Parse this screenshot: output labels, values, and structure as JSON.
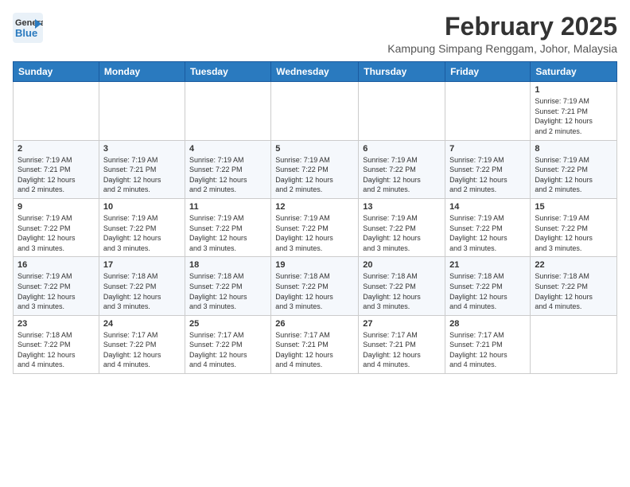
{
  "header": {
    "logo_general": "General",
    "logo_blue": "Blue",
    "month_year": "February 2025",
    "location": "Kampung Simpang Renggam, Johor, Malaysia"
  },
  "days_of_week": [
    "Sunday",
    "Monday",
    "Tuesday",
    "Wednesday",
    "Thursday",
    "Friday",
    "Saturday"
  ],
  "weeks": [
    [
      {
        "day": "",
        "info": ""
      },
      {
        "day": "",
        "info": ""
      },
      {
        "day": "",
        "info": ""
      },
      {
        "day": "",
        "info": ""
      },
      {
        "day": "",
        "info": ""
      },
      {
        "day": "",
        "info": ""
      },
      {
        "day": "1",
        "info": "Sunrise: 7:19 AM\nSunset: 7:21 PM\nDaylight: 12 hours\nand 2 minutes."
      }
    ],
    [
      {
        "day": "2",
        "info": "Sunrise: 7:19 AM\nSunset: 7:21 PM\nDaylight: 12 hours\nand 2 minutes."
      },
      {
        "day": "3",
        "info": "Sunrise: 7:19 AM\nSunset: 7:21 PM\nDaylight: 12 hours\nand 2 minutes."
      },
      {
        "day": "4",
        "info": "Sunrise: 7:19 AM\nSunset: 7:22 PM\nDaylight: 12 hours\nand 2 minutes."
      },
      {
        "day": "5",
        "info": "Sunrise: 7:19 AM\nSunset: 7:22 PM\nDaylight: 12 hours\nand 2 minutes."
      },
      {
        "day": "6",
        "info": "Sunrise: 7:19 AM\nSunset: 7:22 PM\nDaylight: 12 hours\nand 2 minutes."
      },
      {
        "day": "7",
        "info": "Sunrise: 7:19 AM\nSunset: 7:22 PM\nDaylight: 12 hours\nand 2 minutes."
      },
      {
        "day": "8",
        "info": "Sunrise: 7:19 AM\nSunset: 7:22 PM\nDaylight: 12 hours\nand 2 minutes."
      }
    ],
    [
      {
        "day": "9",
        "info": "Sunrise: 7:19 AM\nSunset: 7:22 PM\nDaylight: 12 hours\nand 3 minutes."
      },
      {
        "day": "10",
        "info": "Sunrise: 7:19 AM\nSunset: 7:22 PM\nDaylight: 12 hours\nand 3 minutes."
      },
      {
        "day": "11",
        "info": "Sunrise: 7:19 AM\nSunset: 7:22 PM\nDaylight: 12 hours\nand 3 minutes."
      },
      {
        "day": "12",
        "info": "Sunrise: 7:19 AM\nSunset: 7:22 PM\nDaylight: 12 hours\nand 3 minutes."
      },
      {
        "day": "13",
        "info": "Sunrise: 7:19 AM\nSunset: 7:22 PM\nDaylight: 12 hours\nand 3 minutes."
      },
      {
        "day": "14",
        "info": "Sunrise: 7:19 AM\nSunset: 7:22 PM\nDaylight: 12 hours\nand 3 minutes."
      },
      {
        "day": "15",
        "info": "Sunrise: 7:19 AM\nSunset: 7:22 PM\nDaylight: 12 hours\nand 3 minutes."
      }
    ],
    [
      {
        "day": "16",
        "info": "Sunrise: 7:19 AM\nSunset: 7:22 PM\nDaylight: 12 hours\nand 3 minutes."
      },
      {
        "day": "17",
        "info": "Sunrise: 7:18 AM\nSunset: 7:22 PM\nDaylight: 12 hours\nand 3 minutes."
      },
      {
        "day": "18",
        "info": "Sunrise: 7:18 AM\nSunset: 7:22 PM\nDaylight: 12 hours\nand 3 minutes."
      },
      {
        "day": "19",
        "info": "Sunrise: 7:18 AM\nSunset: 7:22 PM\nDaylight: 12 hours\nand 3 minutes."
      },
      {
        "day": "20",
        "info": "Sunrise: 7:18 AM\nSunset: 7:22 PM\nDaylight: 12 hours\nand 3 minutes."
      },
      {
        "day": "21",
        "info": "Sunrise: 7:18 AM\nSunset: 7:22 PM\nDaylight: 12 hours\nand 4 minutes."
      },
      {
        "day": "22",
        "info": "Sunrise: 7:18 AM\nSunset: 7:22 PM\nDaylight: 12 hours\nand 4 minutes."
      }
    ],
    [
      {
        "day": "23",
        "info": "Sunrise: 7:18 AM\nSunset: 7:22 PM\nDaylight: 12 hours\nand 4 minutes."
      },
      {
        "day": "24",
        "info": "Sunrise: 7:17 AM\nSunset: 7:22 PM\nDaylight: 12 hours\nand 4 minutes."
      },
      {
        "day": "25",
        "info": "Sunrise: 7:17 AM\nSunset: 7:22 PM\nDaylight: 12 hours\nand 4 minutes."
      },
      {
        "day": "26",
        "info": "Sunrise: 7:17 AM\nSunset: 7:21 PM\nDaylight: 12 hours\nand 4 minutes."
      },
      {
        "day": "27",
        "info": "Sunrise: 7:17 AM\nSunset: 7:21 PM\nDaylight: 12 hours\nand 4 minutes."
      },
      {
        "day": "28",
        "info": "Sunrise: 7:17 AM\nSunset: 7:21 PM\nDaylight: 12 hours\nand 4 minutes."
      },
      {
        "day": "",
        "info": ""
      }
    ]
  ]
}
